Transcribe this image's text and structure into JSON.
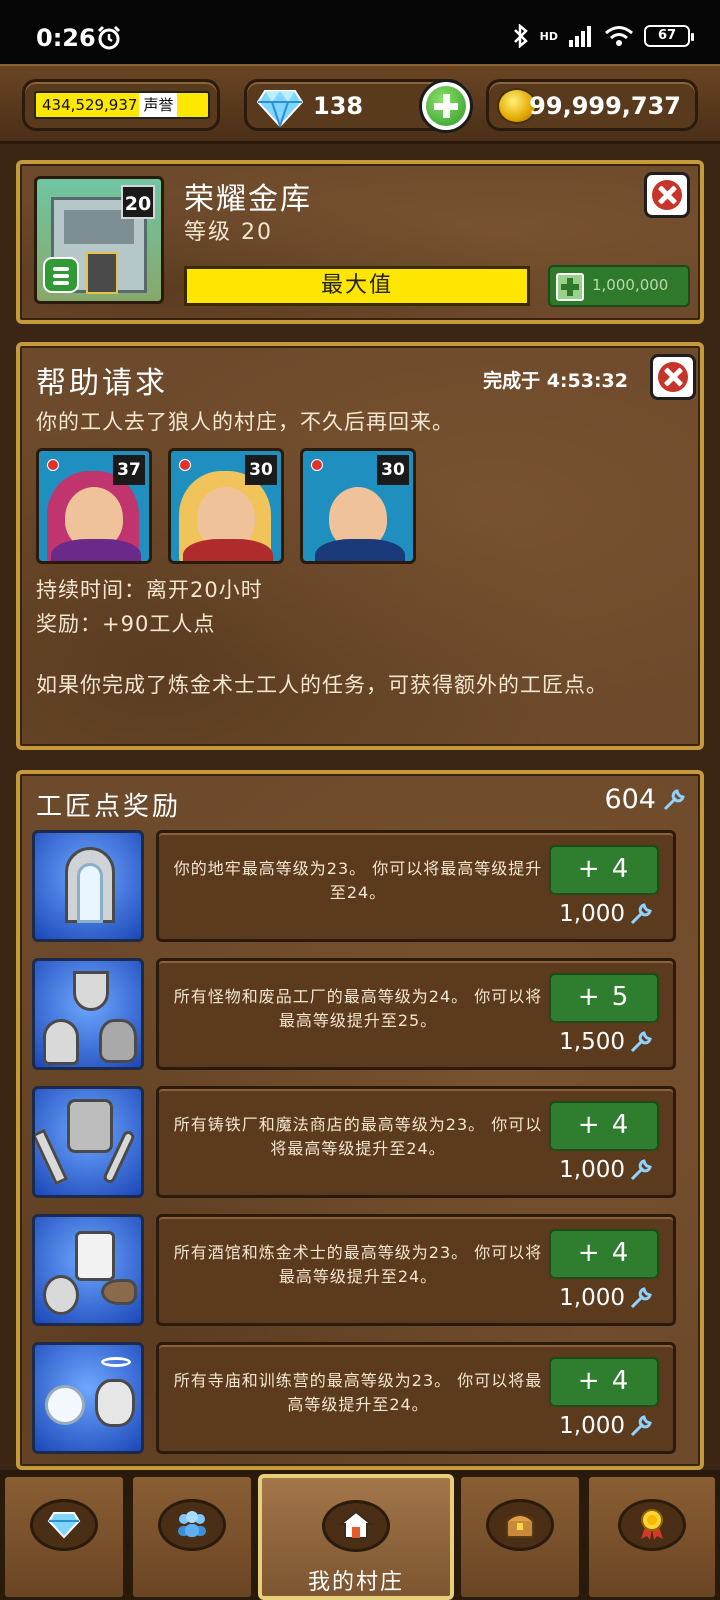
{
  "status_bar": {
    "time": "0:26",
    "network": "HD",
    "battery": "67"
  },
  "resources": {
    "reputation_value": "434,529,937",
    "reputation_suffix": "声誉",
    "gems": "138",
    "gold": "99,999,737"
  },
  "vault": {
    "title": "荣耀金库",
    "level_text": "等级 20",
    "level_badge": "20",
    "progress_label": "最大值",
    "upgrade_cost": "1,000,000"
  },
  "help_request": {
    "title": "帮助请求",
    "complete_label": "完成于 4:53:32",
    "description": "你的工人去了狼人的村庄，不久后再回来。",
    "workers": [
      {
        "level": "37",
        "hair": "#c0356d",
        "body": "#6b2a8a"
      },
      {
        "level": "30",
        "hair": "#f0c45a",
        "body": "#b02b2b"
      },
      {
        "level": "30",
        "hair": "#3a2a1a",
        "body": "#1b3a7a"
      }
    ],
    "duration": "持续时间：离开20小时",
    "reward": "奖励：+90工人点",
    "extra": "如果你完成了炼金术士工人的任务，可获得额外的工匠点。"
  },
  "craftsman": {
    "title": "工匠点奖励",
    "points": "604",
    "rewards": [
      {
        "icon": "dungeon-gate-icon",
        "text": "你的地牢最高等级为23。 你可以将最高等级提升至24。",
        "gain": "+ 4",
        "cost": "1,000"
      },
      {
        "icon": "monster-junk-icon",
        "text": "所有怪物和废品工厂的最高等级为24。 你可以将最高等级提升至25。",
        "gain": "+ 5",
        "cost": "1,500"
      },
      {
        "icon": "forge-magic-icon",
        "text": "所有铸铁厂和魔法商店的最高等级为23。 你可以将最高等级提升至24。",
        "gain": "+ 4",
        "cost": "1,000"
      },
      {
        "icon": "tavern-alchemist-icon",
        "text": "所有酒馆和炼金术士的最高等级为23。 你可以将最高等级提升至24。",
        "gain": "+ 4",
        "cost": "1,000"
      },
      {
        "icon": "temple-training-icon",
        "text": "所有寺庙和训练营的最高等级为23。 你可以将最高等级提升至24。",
        "gain": "+ 4",
        "cost": "1,000"
      }
    ]
  },
  "bottom_nav": {
    "active_label": "我的村庄",
    "items": [
      "gem-shop-icon",
      "friends-icon",
      "home-icon",
      "chest-icon",
      "medal-icon"
    ]
  }
}
